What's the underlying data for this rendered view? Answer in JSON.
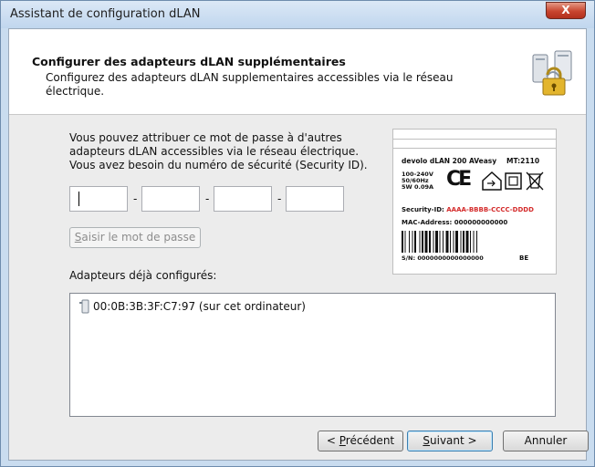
{
  "window": {
    "title": "Assistant de configuration dLAN",
    "close_label": "X"
  },
  "header": {
    "title": "Configurer des adapteurs dLAN supplémentaires",
    "subtitle": "Configurez des adapteurs dLAN supplementaires accessibles via le réseau électrique.",
    "icon": "network-lock-icon"
  },
  "password": {
    "instructions": "Vous pouvez attribuer ce mot de passe à d'autres adapteurs dLAN accessibles via le réseau électrique. Vous avez besoin du numéro de sécurité (Security ID).",
    "fields": [
      "",
      "",
      "",
      ""
    ],
    "separator": "-",
    "button_label": "Saisir le mot de passe",
    "button_mnemonic": "S",
    "button_rest": "aisir le mot de passe"
  },
  "label_card": {
    "product": "devolo dLAN 200 AVeasy",
    "mt": "MT:2110",
    "voltage": [
      "100-240V",
      "50/60Hz",
      "5W 0.09A"
    ],
    "ce": "CE",
    "security_prefix": "Security-ID:",
    "security_value": "AAAA-BBBB-CCCC-DDDD",
    "mac": "MAC-Address: 000000000000",
    "serial": "S/N: 0000000000000000",
    "country": "BE",
    "security_color": "#d42b2b"
  },
  "configured": {
    "label": "Adapteurs déjà configurés:",
    "items": [
      {
        "text": "00:0B:3B:3F:C7:97  (sur cet ordinateur)",
        "icon": "dlan-adapter-icon"
      }
    ]
  },
  "buttons": {
    "previous": {
      "pre": "< ",
      "mnemonic": "P",
      "rest": "récédent"
    },
    "next": {
      "mnemonic": "S",
      "rest": "uivant >"
    },
    "cancel": "Annuler"
  },
  "colors": {
    "frame": "#c9dcef",
    "accent_close": "#c8452f"
  }
}
